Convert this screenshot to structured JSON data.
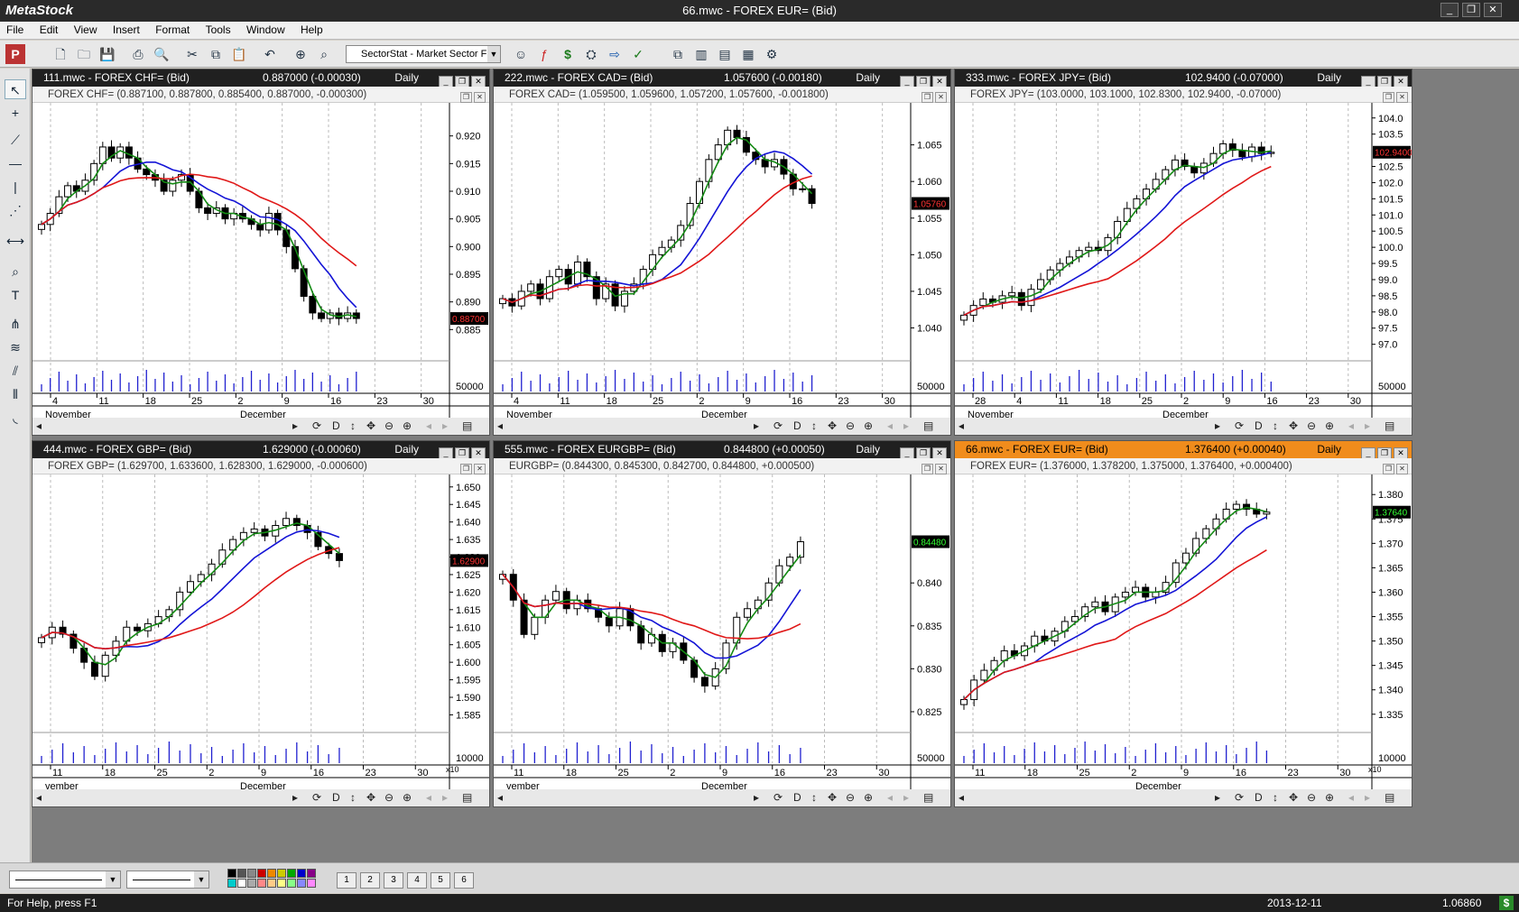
{
  "app": {
    "logo": "MetaStock",
    "title": "66.mwc - FOREX EUR= (Bid)"
  },
  "window_buttons": {
    "minimize": "_",
    "restore": "❐",
    "close": "✕"
  },
  "menu": [
    "File",
    "Edit",
    "View",
    "Insert",
    "Format",
    "Tools",
    "Window",
    "Help"
  ],
  "toolbar": {
    "sector_select": "SectorStat - Market Sector F"
  },
  "colors": {
    "sma_green": "#138a13",
    "sma_blue": "#1414d6",
    "sma_red": "#e01818",
    "volume": "#2020d0",
    "active_title": "#f08c1c"
  },
  "windows": [
    {
      "id": "w1",
      "name": "111.mwc - FOREX CHF= (Bid)",
      "quote": "0.887000 (-0.00030)",
      "period": "Daily",
      "inner": "FOREX CHF= (0.887100, 0.887800, 0.885400, 0.887000, -0.000300)",
      "active": false,
      "chart_data": {
        "type": "candlestick",
        "ylim": [
          0.88,
          0.925
        ],
        "yticks": [
          "0.920",
          "0.915",
          "0.910",
          "0.905",
          "0.900",
          "0.895",
          "0.890",
          "0.885"
        ],
        "last": "0.88700",
        "vol_label": "50000",
        "xticks": [
          "4",
          "11",
          "18",
          "25",
          "2",
          "9",
          "16",
          "23",
          "30"
        ],
        "months": [
          "November",
          "December"
        ],
        "closes": [
          0.904,
          0.906,
          0.909,
          0.911,
          0.91,
          0.912,
          0.915,
          0.918,
          0.916,
          0.918,
          0.916,
          0.914,
          0.913,
          0.912,
          0.91,
          0.912,
          0.913,
          0.91,
          0.907,
          0.906,
          0.907,
          0.905,
          0.906,
          0.905,
          0.904,
          0.903,
          0.906,
          0.903,
          0.9,
          0.896,
          0.891,
          0.888,
          0.887,
          0.888,
          0.887,
          0.888,
          0.887
        ]
      }
    },
    {
      "id": "w2",
      "name": "222.mwc - FOREX CAD= (Bid)",
      "quote": "1.057600 (-0.00180)",
      "period": "Daily",
      "inner": "FOREX CAD= (1.059500, 1.059600, 1.057200, 1.057600, -0.001800)",
      "active": false,
      "chart_data": {
        "type": "candlestick",
        "ylim": [
          1.036,
          1.07
        ],
        "yticks": [
          "1.065",
          "1.060",
          "1.055",
          "1.050",
          "1.045",
          "1.040"
        ],
        "last": "1.05760",
        "vol_label": "50000",
        "xticks": [
          "4",
          "11",
          "18",
          "25",
          "2",
          "9",
          "16",
          "23",
          "30"
        ],
        "months": [
          "November",
          "December"
        ],
        "closes": [
          1.044,
          1.043,
          1.045,
          1.046,
          1.044,
          1.047,
          1.048,
          1.046,
          1.049,
          1.047,
          1.044,
          1.046,
          1.043,
          1.045,
          1.046,
          1.048,
          1.05,
          1.051,
          1.052,
          1.054,
          1.057,
          1.06,
          1.063,
          1.065,
          1.067,
          1.066,
          1.064,
          1.063,
          1.062,
          1.063,
          1.061,
          1.059,
          1.059,
          1.057
        ]
      }
    },
    {
      "id": "w3",
      "name": "333.mwc - FOREX JPY= (Bid)",
      "quote": "102.9400 (-0.07000)",
      "period": "Daily",
      "inner": "FOREX JPY= (103.0000, 103.1000, 102.8300, 102.9400, -0.07000)",
      "active": false,
      "chart_data": {
        "type": "candlestick",
        "ylim": [
          96.6,
          104.3
        ],
        "yticks": [
          "104.0",
          "103.5",
          "102.5",
          "102.0",
          "101.5",
          "101.0",
          "100.5",
          "100.0",
          "99.5",
          "99.0",
          "98.5",
          "98.0",
          "97.5",
          "97.0"
        ],
        "last": "102.9400",
        "vol_label": "50000",
        "xticks": [
          "28",
          "4",
          "11",
          "18",
          "25",
          "2",
          "9",
          "16",
          "23",
          "30"
        ],
        "months": [
          "November",
          "December"
        ],
        "closes": [
          97.9,
          98.2,
          98.4,
          98.3,
          98.5,
          98.6,
          98.2,
          98.7,
          99.0,
          99.3,
          99.5,
          99.7,
          99.9,
          100.0,
          99.9,
          100.3,
          100.8,
          101.2,
          101.5,
          101.8,
          102.1,
          102.4,
          102.7,
          102.5,
          102.3,
          102.6,
          102.9,
          103.2,
          103.0,
          102.8,
          103.1,
          102.9,
          102.94
        ]
      }
    },
    {
      "id": "w4",
      "name": "444.mwc - FOREX GBP= (Bid)",
      "quote": "1.629000 (-0.00060)",
      "period": "Daily",
      "inner": "FOREX GBP= (1.629700, 1.633600, 1.628300, 1.629000, -0.000600)",
      "active": false,
      "chart_data": {
        "type": "candlestick",
        "ylim": [
          1.581,
          1.652
        ],
        "yticks": [
          "1.650",
          "1.645",
          "1.640",
          "1.635",
          "1.630",
          "1.625",
          "1.620",
          "1.615",
          "1.610",
          "1.605",
          "1.600",
          "1.595",
          "1.590",
          "1.585"
        ],
        "last": "1.62900",
        "vol_label": "10000",
        "vol_mult": "x10",
        "xticks": [
          "11",
          "18",
          "25",
          "2",
          "9",
          "16",
          "23",
          "30"
        ],
        "months": [
          "vember",
          "December"
        ],
        "closes": [
          1.607,
          1.61,
          1.608,
          1.604,
          1.6,
          1.596,
          1.602,
          1.606,
          1.61,
          1.609,
          1.611,
          1.613,
          1.615,
          1.62,
          1.623,
          1.625,
          1.628,
          1.632,
          1.635,
          1.637,
          1.638,
          1.636,
          1.639,
          1.641,
          1.639,
          1.637,
          1.633,
          1.631,
          1.629
        ]
      }
    },
    {
      "id": "w5",
      "name": "555.mwc - FOREX EURGBP= (Bid)",
      "quote": "0.844800 (+0.00050)",
      "period": "Daily",
      "inner": "EURGBP= (0.844300, 0.845300, 0.842700, 0.844800, +0.000500)",
      "active": false,
      "chart_data": {
        "type": "candlestick",
        "ylim": [
          0.823,
          0.852
        ],
        "yticks": [
          "0.840",
          "0.835",
          "0.830",
          "0.825"
        ],
        "last": "0.84480",
        "vol_label": "50000",
        "xticks": [
          "11",
          "18",
          "25",
          "2",
          "9",
          "16",
          "23",
          "30"
        ],
        "months": [
          "vember",
          "December"
        ],
        "closes": [
          0.841,
          0.838,
          0.834,
          0.836,
          0.838,
          0.839,
          0.837,
          0.838,
          0.837,
          0.836,
          0.835,
          0.837,
          0.835,
          0.833,
          0.834,
          0.832,
          0.833,
          0.831,
          0.829,
          0.828,
          0.83,
          0.833,
          0.836,
          0.837,
          0.838,
          0.84,
          0.842,
          0.843,
          0.8448
        ]
      }
    },
    {
      "id": "w6",
      "name": "66.mwc - FOREX EUR= (Bid)",
      "quote": "1.376400 (+0.00040)",
      "period": "Daily",
      "inner": "FOREX EUR= (1.376000, 1.378200, 1.375000, 1.376400, +0.000400)",
      "active": true,
      "chart_data": {
        "type": "candlestick",
        "ylim": [
          1.332,
          1.383
        ],
        "yticks": [
          "1.380",
          "1.375",
          "1.370",
          "1.365",
          "1.360",
          "1.355",
          "1.350",
          "1.345",
          "1.340",
          "1.335"
        ],
        "last": "1.37640",
        "vol_label": "10000",
        "vol_mult": "x10",
        "xticks": [
          "11",
          "18",
          "25",
          "2",
          "9",
          "16",
          "23",
          "30"
        ],
        "months": [
          "December"
        ],
        "closes": [
          1.338,
          1.342,
          1.344,
          1.346,
          1.348,
          1.347,
          1.349,
          1.351,
          1.35,
          1.352,
          1.354,
          1.355,
          1.357,
          1.358,
          1.356,
          1.359,
          1.36,
          1.361,
          1.359,
          1.36,
          1.362,
          1.366,
          1.368,
          1.371,
          1.373,
          1.375,
          1.377,
          1.378,
          1.377,
          1.376,
          1.3764
        ]
      }
    }
  ],
  "statusbar": {
    "help": "For Help, press F1",
    "date": "2013-12-11",
    "value": "1.06860"
  },
  "layout_buttons": [
    "1",
    "2",
    "3",
    "4",
    "5",
    "6"
  ]
}
